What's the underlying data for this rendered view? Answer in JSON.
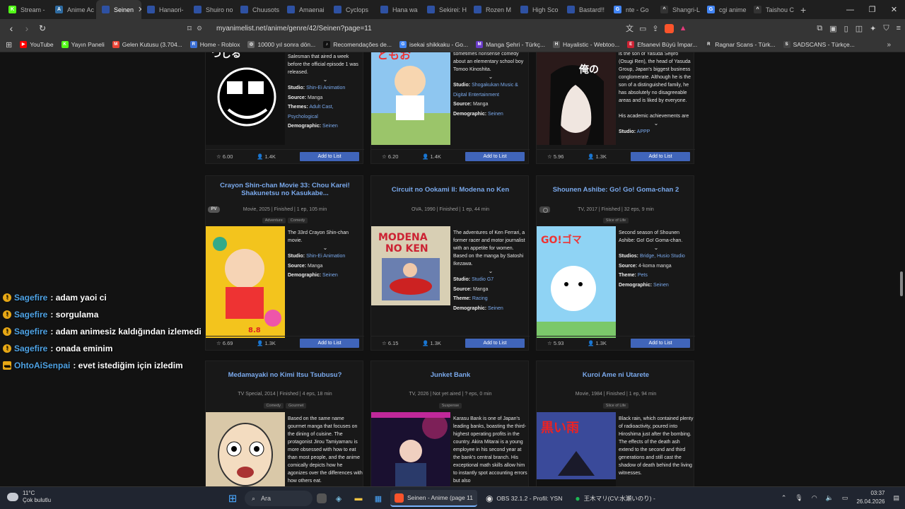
{
  "tabs": [
    {
      "label": "Stream -",
      "fav": "K",
      "color": "#53fc18"
    },
    {
      "label": "Anime Ac",
      "fav": "A",
      "color": "#2d6aa0"
    },
    {
      "label": "Seinen",
      "fav": "MAL",
      "color": "#2e51a2",
      "active": true
    },
    {
      "label": "Hanaori-",
      "fav": "MAL",
      "color": "#2e51a2"
    },
    {
      "label": "Shuiro no",
      "fav": "MAL",
      "color": "#2e51a2"
    },
    {
      "label": "Chuusots",
      "fav": "MAL",
      "color": "#2e51a2"
    },
    {
      "label": "Amaenai",
      "fav": "MAL",
      "color": "#2e51a2"
    },
    {
      "label": "Cyclops",
      "fav": "MAL",
      "color": "#2e51a2"
    },
    {
      "label": "Hana wa",
      "fav": "MAL",
      "color": "#2e51a2"
    },
    {
      "label": "Sekirei: H",
      "fav": "MAL",
      "color": "#2e51a2"
    },
    {
      "label": "Rozen M",
      "fav": "MAL",
      "color": "#2e51a2"
    },
    {
      "label": "High Sco",
      "fav": "MAL",
      "color": "#2e51a2"
    },
    {
      "label": "Bastard!!",
      "fav": "MAL",
      "color": "#2e51a2"
    },
    {
      "label": "nte - Go",
      "fav": "G",
      "color": "#4285f4"
    },
    {
      "label": "Shangri-L",
      "fav": "^",
      "color": "#333"
    },
    {
      "label": "cgi anime",
      "fav": "G",
      "color": "#4285f4"
    },
    {
      "label": "Taishou C",
      "fav": "^",
      "color": "#333"
    }
  ],
  "address": {
    "url": "myanimelist.net/anime/genre/42/Seinen?page=11"
  },
  "bookmarks": [
    {
      "label": "YouTube",
      "color": "#ff0000",
      "glyph": "▶"
    },
    {
      "label": "Yayın Paneli",
      "color": "#53fc18",
      "glyph": "K"
    },
    {
      "label": "Gelen Kutusu (3.704...",
      "color": "#ea4335",
      "glyph": "M"
    },
    {
      "label": "Home - Roblox",
      "color": "#3b6fd6",
      "glyph": "R"
    },
    {
      "label": "10000 yıl sonra dön...",
      "color": "#666",
      "glyph": "◎"
    },
    {
      "label": "Recomendações de...",
      "color": "#111",
      "glyph": "♪"
    },
    {
      "label": "isekai shikkaku - Go...",
      "color": "#4285f4",
      "glyph": "G"
    },
    {
      "label": "Manga Şehri - Türkç...",
      "color": "#6a3cc9",
      "glyph": "M"
    },
    {
      "label": "Hayalistic - Webtoo...",
      "color": "#555",
      "glyph": "H"
    },
    {
      "label": "Efsanevi Büyü İmpar...",
      "color": "#c23",
      "glyph": "E"
    },
    {
      "label": "Ragnar Scans - Türk...",
      "color": "#333",
      "glyph": "R"
    },
    {
      "label": "SADSCANS - Türkçe...",
      "color": "#444",
      "glyph": "S"
    }
  ],
  "cards_top": [
    {
      "poster": "p1",
      "synopsis": "Salesman that aired a week before the official episode 1 was released.",
      "chev": true,
      "props": [
        [
          "Studio:",
          "Shin-Ei Animation"
        ],
        [
          "Source:",
          "Manga"
        ],
        [
          "Themes:",
          "Adult Cast, Psychological"
        ],
        [
          "Demographic:",
          "Seinen"
        ]
      ],
      "score": "6.00",
      "members": "1.4K",
      "add": "Add to List"
    },
    {
      "poster": "p2",
      "synopsis": "sometimes nonsense comedy about an elementary school boy Tomoo Kinoshita.",
      "chev": true,
      "props": [
        [
          "Studio:",
          "Shogakukan Music & Digital Entertainment"
        ],
        [
          "Source:",
          "Manga"
        ],
        [
          "Demographic:",
          "Seinen"
        ]
      ],
      "score": "6.20",
      "members": "1.4K",
      "add": "Add to List"
    },
    {
      "poster": "p3",
      "synopsis": "is the son of Yasuda Seijiro (Osugi Ren), the head of Yasuda Group, Japan's biggest business conglomerate. Although he is the son of a distinguished family, he has absolutely no disagreeable areas and is liked by everyone.\n\nHis academic achievements are",
      "chev": true,
      "props": [
        [
          "Studio:",
          "APPP"
        ]
      ],
      "score": "5.96",
      "members": "1.3K",
      "add": "Add to List"
    }
  ],
  "cards_mid": [
    {
      "title": "Crayon Shin-chan Movie 33: Chou Karei! Shakunetsu no Kasukabe...",
      "badge": "PV",
      "info": "Movie, 2025 | Finished | 1 ep, 105 min",
      "genres": [
        "Adventure",
        "Comedy"
      ],
      "poster": "p4",
      "synopsis": "The 33rd Crayon Shin-chan movie.",
      "props": [
        [
          "Studio:",
          "Shin-Ei Animation"
        ],
        [
          "Source:",
          "Manga"
        ],
        [
          "Demographic:",
          "Seinen"
        ]
      ],
      "score": "6.69",
      "members": "1.3K",
      "add": "Add to List"
    },
    {
      "title": "Circuit no Ookami II: Modena no Ken",
      "badge": "",
      "info": "OVA, 1990 | Finished | 1 ep, 44 min",
      "genres": [],
      "poster": "p5",
      "synopsis": "The adventures of Ken Ferrari, a former racer and motor journalist with an appetite for women. Based on the manga by Satoshi Ikezawa.",
      "props": [
        [
          "Studio:",
          "Studio G7"
        ],
        [
          "Source:",
          "Manga"
        ],
        [
          "Theme:",
          "Racing"
        ],
        [
          "Demographic:",
          "Seinen"
        ]
      ],
      "score": "6.15",
      "members": "1.3K",
      "add": "Add to List"
    },
    {
      "title": "Shounen Ashibe: Go! Go! Goma-chan 2",
      "badge": "cam",
      "info": "TV, 2017 | Finished | 32 eps, 9 min",
      "genres": [
        "Slice of Life"
      ],
      "poster": "p6",
      "synopsis": "Second season of Shounen Ashibe: Go! Go! Goma-chan.",
      "props": [
        [
          "Studios:",
          "Bridge, Husio Studio"
        ],
        [
          "Source:",
          "4-koma manga"
        ],
        [
          "Theme:",
          "Pets"
        ],
        [
          "Demographic:",
          "Seinen"
        ]
      ],
      "score": "5.93",
      "members": "1.3K",
      "add": "Add to List"
    }
  ],
  "cards_bot": [
    {
      "title": "Medamayaki no Kimi Itsu Tsubusu?",
      "info": "TV Special, 2014 | Finished | 4 eps, 18 min",
      "genres": [
        "Comedy",
        "Gourmet"
      ],
      "poster": "p7",
      "synopsis": "Based on the same name gourmet manga that focuses on the dining of cuisine. The protagonist Jirou Tamiyamaru is more obsessed with how to eat than most people, and the anime comically depicts how he agonizes over the differences with how others eat."
    },
    {
      "title": "Junket Bank",
      "info": "TV, 2026 | Not yet aired | ? eps, 0 min",
      "genres": [
        "Suspense"
      ],
      "poster": "p8",
      "synopsis": "Karasu Bank is one of Japan's leading banks, boasting the third-highest operating profits in the country. Akira Mitarai is a young employee in his second year at the bank's central branch. His exceptional math skills allow him to instantly spot accounting errors but also"
    },
    {
      "title": "Kuroi Ame ni Utarete",
      "info": "Movie, 1984 | Finished | 1 ep, 94 min",
      "genres": [
        "Slice of Life"
      ],
      "poster": "p9",
      "synopsis": "Black rain, which contained plenty of radioactivity, poured into Hiroshima just after the bombing. The effects of the death ash extend to the second and third generations and still cast the shadow of death behind the living witnesses."
    }
  ],
  "chat": [
    {
      "user": "Sagefire",
      "msg": ": adam yaoi ci"
    },
    {
      "user": "Sagefire",
      "msg": ": sorgulama"
    },
    {
      "user": "Sagefire",
      "msg": ": adam animesiz kaldığından izlemedi"
    },
    {
      "user": "Sagefire",
      "msg": ": onada eminim"
    },
    {
      "user": "OhtoAiSenpai",
      "msg": ": evet istediğim için izledim"
    }
  ],
  "taskbar": {
    "weather_temp": "11°C",
    "weather_desc": "Çok bulutlu",
    "search": "Ara",
    "app1": "Seinen - Anime (page 11",
    "app2": "OBS 32.1.2 - Profil: YSN",
    "app3": "王木マリ(CV:水瀬いのり) -",
    "time": "03:37",
    "date": "26.04.2026"
  }
}
